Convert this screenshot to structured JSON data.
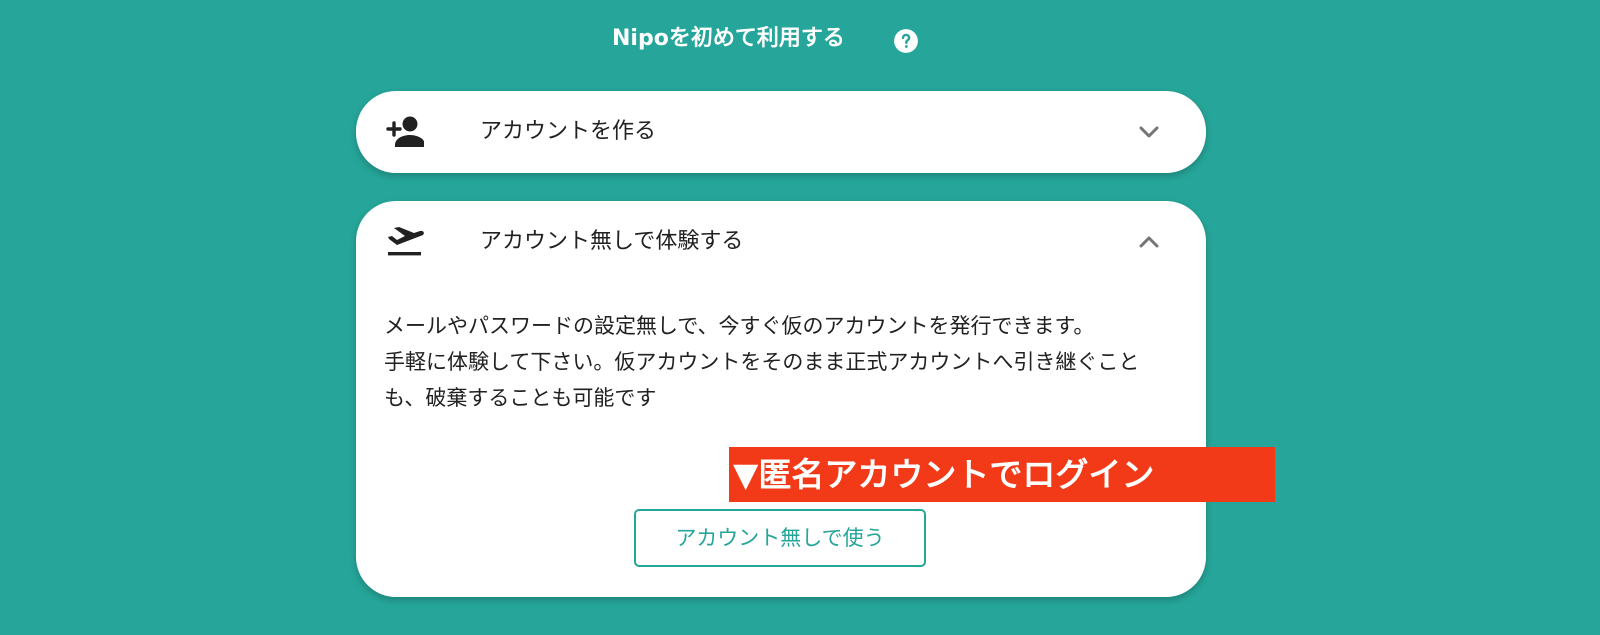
{
  "header": {
    "title": "Nipoを初めて利用する",
    "help_icon": "help-circle-icon"
  },
  "cards": {
    "create": {
      "icon": "person-add-icon",
      "title": "アカウントを作る",
      "chevron": "chevron-down-icon"
    },
    "trial": {
      "icon": "flight-takeoff-icon",
      "title": "アカウント無しで体験する",
      "chevron": "chevron-up-icon",
      "description_line1": "メールやパスワードの設定無しで、今すぐ仮のアカウントを発行できます。",
      "description_line2": "手軽に体験して下さい。仮アカウントをそのまま正式アカウントへ引き継ぐことも、破棄することも可能です",
      "button_label": "アカウント無しで使う"
    }
  },
  "annotation": {
    "text": "▼匿名アカウントでログイン"
  },
  "colors": {
    "background": "#26a69a",
    "card": "#ffffff",
    "accent": "#26a69a",
    "annotation": "#f23a19"
  }
}
